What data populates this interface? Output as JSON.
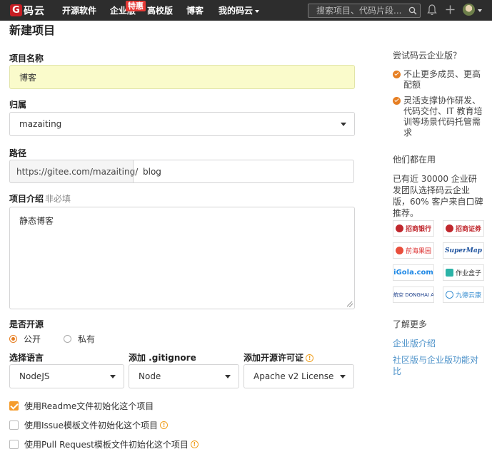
{
  "nav": {
    "logo_glyph": "G",
    "logo_text": "码云",
    "items": [
      "开源软件",
      "企业版",
      "高校版",
      "博客",
      "我的码云"
    ],
    "hot_badge": "特惠",
    "search_placeholder": "搜索项目、代码片段..."
  },
  "form": {
    "page_title": "新建项目",
    "name_label": "项目名称",
    "name_value": "博客",
    "owner_label": "归属",
    "owner_value": "mazaiting",
    "path_label": "路径",
    "path_prefix": "https://gitee.com/mazaiting/",
    "path_value": "blog",
    "desc_label": "项目介绍",
    "desc_optional": "非必填",
    "desc_value": "静态博客",
    "visibility_label": "是否开源",
    "visibility_public": "公开",
    "visibility_private": "私有",
    "language_label": "选择语言",
    "language_value": "NodeJS",
    "gitignore_label": "添加 .gitignore",
    "gitignore_value": "Node",
    "license_label": "添加开源许可证",
    "license_value": "Apache v2 License",
    "readme_label": "使用Readme文件初始化这个项目",
    "issue_label": "使用Issue模板文件初始化这个项目",
    "pr_label": "使用Pull Request模板文件初始化这个项目",
    "readme_checked": true,
    "issue_checked": false,
    "pr_checked": false
  },
  "sidebar": {
    "enterprise_title": "尝试码云企业版？",
    "benefit_1": "不止更多成员、更高配额",
    "benefit_2": "灵活支撑协作研发、代码交付、IT 教育培训等场景代码托管需求",
    "users_title": "他们都在用",
    "users_text": "已有近 30000 企业研发团队选择码云企业版，60% 客户来自口碑推荐。",
    "clients": [
      "招商银行",
      "招商证券",
      "前海果园",
      "SuperMap",
      "iGola.com",
      "作业盒子",
      "东海航空 DONGHAI AIRLINES",
      "九德云康"
    ],
    "learn_title": "了解更多",
    "link_1": "企业版介绍",
    "link_2": "社区版与企业版功能对比"
  },
  "colors": {
    "accent": "#e67e22",
    "link": "#4a90c8",
    "topbar": "#2d2d2d",
    "brand_red": "#c71d23"
  }
}
